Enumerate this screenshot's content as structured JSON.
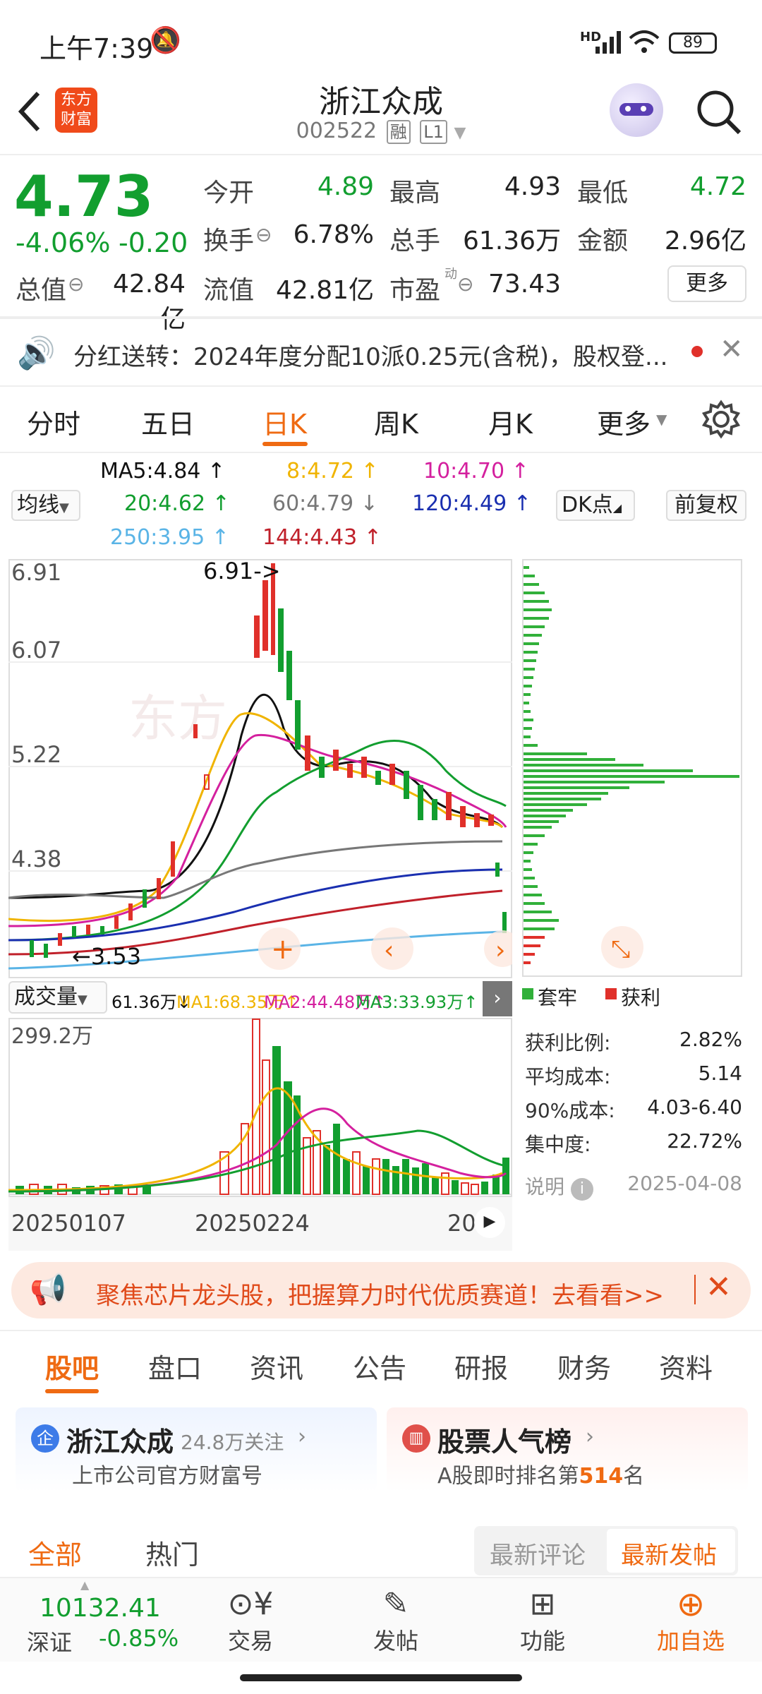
{
  "status_bar": {
    "time": "上午7:39",
    "battery": "89",
    "hd": "HD"
  },
  "header": {
    "title": "浙江众成",
    "code": "002522",
    "tag_margin": "融",
    "tag_level": "L1"
  },
  "quote": {
    "price": "4.73",
    "change_pct": "-4.06%",
    "change": "-0.20",
    "open_label": "今开",
    "open": "4.89",
    "high_label": "最高",
    "high": "4.93",
    "low_label": "最低",
    "low": "4.72",
    "turnover_label": "换手",
    "turnover": "6.78%",
    "volume_label": "总手",
    "volume": "61.36万",
    "amount_label": "金额",
    "amount": "2.96亿",
    "mktcap_label": "总值",
    "mktcap": "42.84亿",
    "float_label": "流值",
    "float": "42.81亿",
    "pe_label": "市盈",
    "pe_sup": "动",
    "pe": "73.43",
    "more_label": "更多"
  },
  "notice": {
    "text": "分红送转：2024年度分配10派0.25元(含税)，股权登..."
  },
  "chart_tabs": [
    "分时",
    "五日",
    "日K",
    "周K",
    "月K",
    "更多"
  ],
  "active_tab": "日K",
  "ma": {
    "selector": "均线",
    "ma5": "MA5:4.84",
    "ma8": "8:4.72",
    "ma10": "10:4.70",
    "ma20": "20:4.62",
    "ma60": "60:4.79",
    "ma120": "120:4.49",
    "ma250": "250:3.95",
    "ma144": "144:4.43",
    "dk_label": "DK点",
    "fq_label": "前复权"
  },
  "kline": {
    "y_labels": [
      "6.91",
      "6.07",
      "5.22",
      "4.38",
      "3.53"
    ],
    "max_marker": "6.91->",
    "min_marker": "3.53"
  },
  "volume_bar": {
    "selector": "成交量",
    "vol": "61.36万",
    "ma1": "MA1:68.35万",
    "ma2": "MA2:44.48万",
    "ma3": "MA3:33.93万",
    "max": "299.2万",
    "dates": [
      "20250107",
      "20250224",
      "20"
    ]
  },
  "chip_dist": {
    "legend_trap": "套牢",
    "legend_profit": "获利",
    "stats": [
      {
        "k": "获利比例:",
        "v": "2.82%"
      },
      {
        "k": "平均成本:",
        "v": "5.14"
      },
      {
        "k": "90%成本:",
        "v": "4.03-6.40"
      },
      {
        "k": "集中度:",
        "v": "22.72%"
      }
    ],
    "note_label": "说明",
    "date": "2025-04-08"
  },
  "promo": {
    "text": "聚焦芯片龙头股，把握算力时代优质赛道！去看看>>"
  },
  "news_tabs": [
    "股吧",
    "盘口",
    "资讯",
    "公告",
    "研报",
    "财务",
    "资料"
  ],
  "active_news_tab": "股吧",
  "cards": {
    "left_title": "浙江众成",
    "left_follow": "24.8万关注",
    "left_sub": "上市公司官方财富号",
    "right_title": "股票人气榜",
    "right_sub_pre": "A股即时排名第",
    "right_rank": "514",
    "right_sub_post": "名"
  },
  "filter": {
    "all": "全部",
    "hot": "热门",
    "latest_comment": "最新评论",
    "latest_post": "最新发帖"
  },
  "bottom": {
    "index_value": "10132.41",
    "index_name": "深证",
    "index_change": "-0.85%",
    "trade": "交易",
    "post": "发帖",
    "func": "功能",
    "add": "加自选"
  },
  "colors": {
    "up": "#e0302a",
    "down": "#129e2f",
    "accent": "#ef6a12",
    "ma5": "#111111",
    "ma8": "#f0b400",
    "ma10": "#d4209e",
    "ma20": "#129e2f",
    "ma60": "#888888",
    "ma120": "#1a2fb0",
    "ma250": "#5ab4e6",
    "ma144": "#c0202a"
  }
}
